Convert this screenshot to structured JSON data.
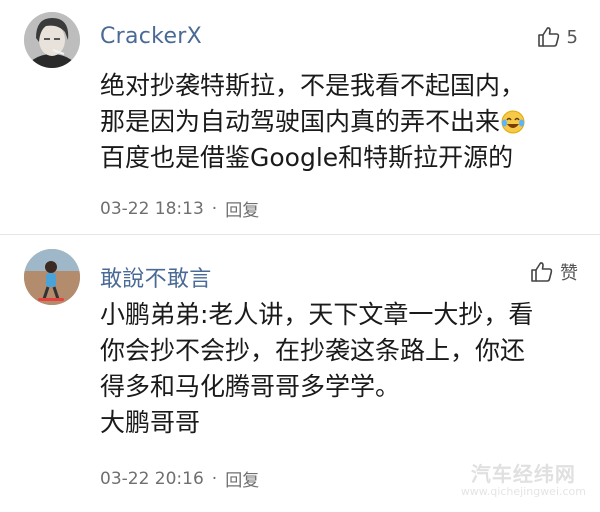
{
  "comments": [
    {
      "username": "CrackerX",
      "like_count": "5",
      "lines": [
        "绝对抄袭特斯拉，不是我看不起国内，",
        "那是因为自动驾驶国内真的弄不出来",
        "百度也是借鉴Google和特斯拉开源的"
      ],
      "emoji": "laughing-crying-emoji",
      "time": "03-22 18:13",
      "separator": "·",
      "reply_label": "回复"
    },
    {
      "username": "敢說不敢言",
      "like_label": "赞",
      "lines": [
        "小鹏弟弟:老人讲，天下文章一大抄，看",
        "你会抄不会抄，在抄袭这条路上，你还",
        "得多和马化腾哥哥多学学。",
        "大鹏哥哥"
      ],
      "time": "03-22 20:16",
      "separator": "·",
      "reply_label": "回复"
    }
  ],
  "watermark": {
    "text": "汽车经纬网",
    "url": "www.qichejingwei.com"
  },
  "colors": {
    "username": "#4a6a96",
    "text": "#1a1a1a",
    "meta": "#6f6f6f",
    "divider": "#e6e6e6"
  }
}
